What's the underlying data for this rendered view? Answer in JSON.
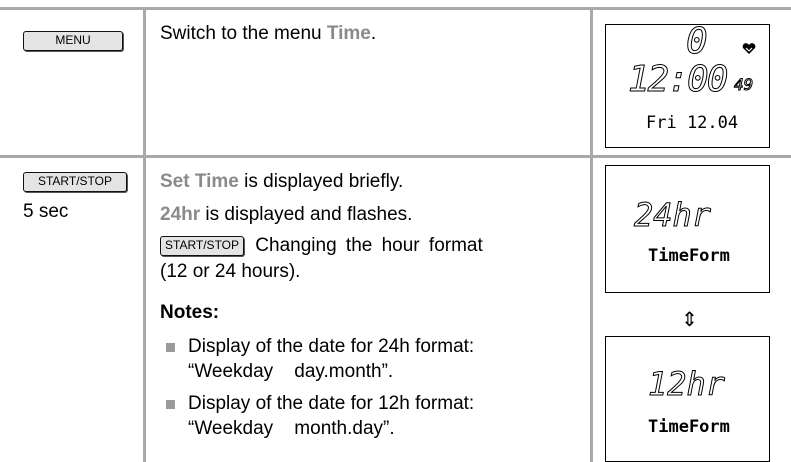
{
  "row1": {
    "key_label": "MENU",
    "desc_prefix": "Switch to the menu ",
    "desc_highlight": "Time",
    "desc_suffix": ".",
    "display": {
      "top_digit": "0",
      "time": "12:00",
      "seconds": "49",
      "date": "Fri  12.04",
      "icon": "heart-icon"
    }
  },
  "row2": {
    "key_label": "START/STOP",
    "duration": "5 sec",
    "line1_highlight": "Set Time",
    "line1_suffix": " is displayed briefly.",
    "line2_highlight": "24hr",
    "line2_suffix": " is displayed and flashes.",
    "inline_key_label": "START/STOP",
    "line3a": "Changing the hour format",
    "line3b": "(12 or 24 hours).",
    "notes_heading": "Notes:",
    "notes": [
      {
        "line1": "Display of the date for 24h format:",
        "line2": "“Weekday    day.month”."
      },
      {
        "line1": "Display of the date for 12h format:",
        "line2": "“Weekday    month.day”."
      }
    ],
    "display_24": {
      "big": "24hr",
      "label": "TimeForm"
    },
    "swap_arrow": "⇕",
    "display_12": {
      "big": "12hr",
      "label": "TimeForm"
    }
  },
  "colors": {
    "rule": "#a9a9a9",
    "highlight": "#8a8a8a",
    "key_bg": "#e4e4e4"
  }
}
